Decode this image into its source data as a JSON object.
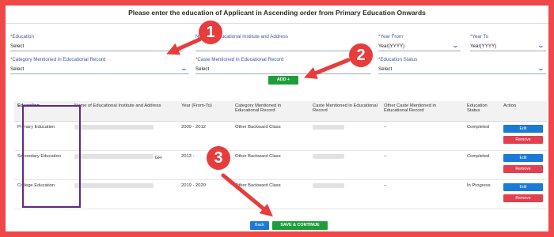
{
  "heading": "Please enter the education of Applicant in Ascending order from Primary Education Onwards",
  "form": {
    "education": {
      "label": "Education",
      "value": "Select"
    },
    "institute": {
      "label": "Name of Educational Institute and Address"
    },
    "year_from": {
      "label": "Year From",
      "value": "Year(YYYY)"
    },
    "year_to": {
      "label": "Year To",
      "value": "Year(YYYY)"
    },
    "category": {
      "label": "Category Mentioned in Educational Record",
      "value": "Select"
    },
    "caste": {
      "label": "Caste Mentioned in Educational Record",
      "value": "Select"
    },
    "status": {
      "label": "Education Status",
      "value": "Select"
    },
    "add_button": "ADD +"
  },
  "table": {
    "headers": [
      "Education",
      "Name of Educational Institute and Address",
      "Year (From-To)",
      "Category Mentioned in Educational Record",
      "Caste Mentioned in Educational Record",
      "Other Caste Mentioned in Educational Record",
      "Education Status",
      "Action"
    ],
    "rows": [
      {
        "education": "Primary Education",
        "institute": "",
        "years": "2009 - 2012",
        "category": "Other Backward Class",
        "caste": "",
        "other_caste": "--",
        "status": "Completed"
      },
      {
        "education": "Secondary Education",
        "institute": "GH",
        "years": "2013 -",
        "category": "Other Backward Class",
        "caste": "",
        "other_caste": "--",
        "status": "Completed"
      },
      {
        "education": "College Education",
        "institute": "",
        "years": "2019 - 2020",
        "category": "Other Backward Class",
        "caste": "",
        "other_caste": "--",
        "status": "In Progress"
      }
    ],
    "edit_label": "Edit",
    "remove_label": "Remove"
  },
  "footer": {
    "back_label": "Back",
    "save_label": "SAVE & CONTINUE"
  },
  "annotations": {
    "badge_1": "1",
    "badge_2": "2",
    "badge_3": "3"
  },
  "colors": {
    "frame": "#f04848",
    "badge": "#e83c3c",
    "add_green": "#1e9e3a",
    "edit_blue": "#1b7ad6",
    "remove_red": "#e04050",
    "highlight_purple": "#5e2a84",
    "label_blue": "#3b5b9b"
  },
  "icons": [
    "chevron-down-icon",
    "plus-icon",
    "arrow-icon"
  ]
}
